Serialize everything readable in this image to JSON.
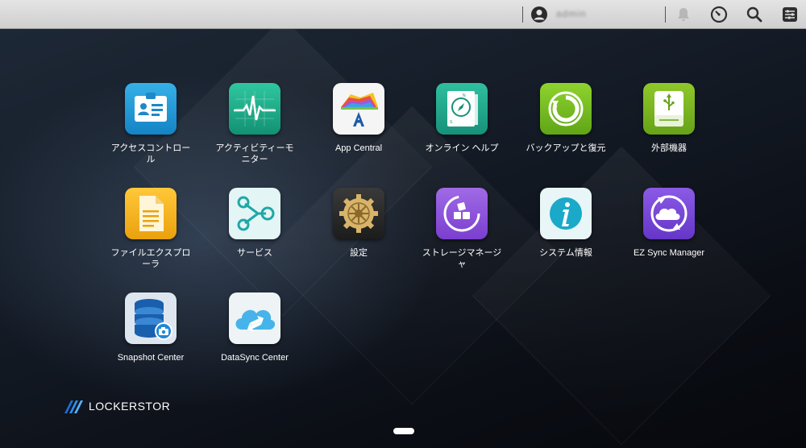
{
  "topbar": {
    "username": "admin",
    "icons": [
      "user-avatar-icon",
      "bell-icon",
      "dashboard-gauge-icon",
      "search-icon",
      "settings-sliders-icon"
    ]
  },
  "apps": [
    {
      "id": "access-control",
      "label": "アクセスコントロール",
      "icon": "id-card-icon",
      "bg": "#1f9ad6"
    },
    {
      "id": "activity-monitor",
      "label": "アクティビティーモニター",
      "icon": "heartbeat-monitor-icon",
      "bg": "#1fae8a"
    },
    {
      "id": "app-central",
      "label": "App Central",
      "icon": "app-central-icon",
      "bg": "#f4f4f4"
    },
    {
      "id": "online-help",
      "label": "オンライン ヘルプ",
      "icon": "compass-book-icon",
      "bg": "#25a78e"
    },
    {
      "id": "backup-restore",
      "label": "バックアップと復元",
      "icon": "backup-cycle-icon",
      "bg": "#7cc225"
    },
    {
      "id": "external-devices",
      "label": "外部機器",
      "icon": "usb-drive-icon",
      "bg": "#7fb520"
    },
    {
      "id": "file-explorer",
      "label": "ファイルエクスプローラ",
      "icon": "folder-document-icon",
      "bg": "#f2b21a"
    },
    {
      "id": "services",
      "label": "サービス",
      "icon": "services-nodes-icon",
      "bg": "#e2f4f4"
    },
    {
      "id": "settings",
      "label": "設定",
      "icon": "gear-icon",
      "bg": "#2a2a2a"
    },
    {
      "id": "storage-manager",
      "label": "ストレージマネージャ",
      "icon": "storage-blocks-icon",
      "bg": "#8a4fd8"
    },
    {
      "id": "system-info",
      "label": "システム情報",
      "icon": "info-icon",
      "bg": "#eaf6f8"
    },
    {
      "id": "ez-sync",
      "label": "EZ Sync Manager",
      "icon": "cloud-sync-icon",
      "bg": "#7a49d6"
    },
    {
      "id": "snapshot-center",
      "label": "Snapshot Center",
      "icon": "database-camera-icon",
      "bg": "#dfe7ef"
    },
    {
      "id": "datasync-center",
      "label": "DataSync Center",
      "icon": "cloud-arrows-icon",
      "bg": "#f2f6f8"
    }
  ],
  "brand": {
    "name": "LOCKERSTOR"
  }
}
